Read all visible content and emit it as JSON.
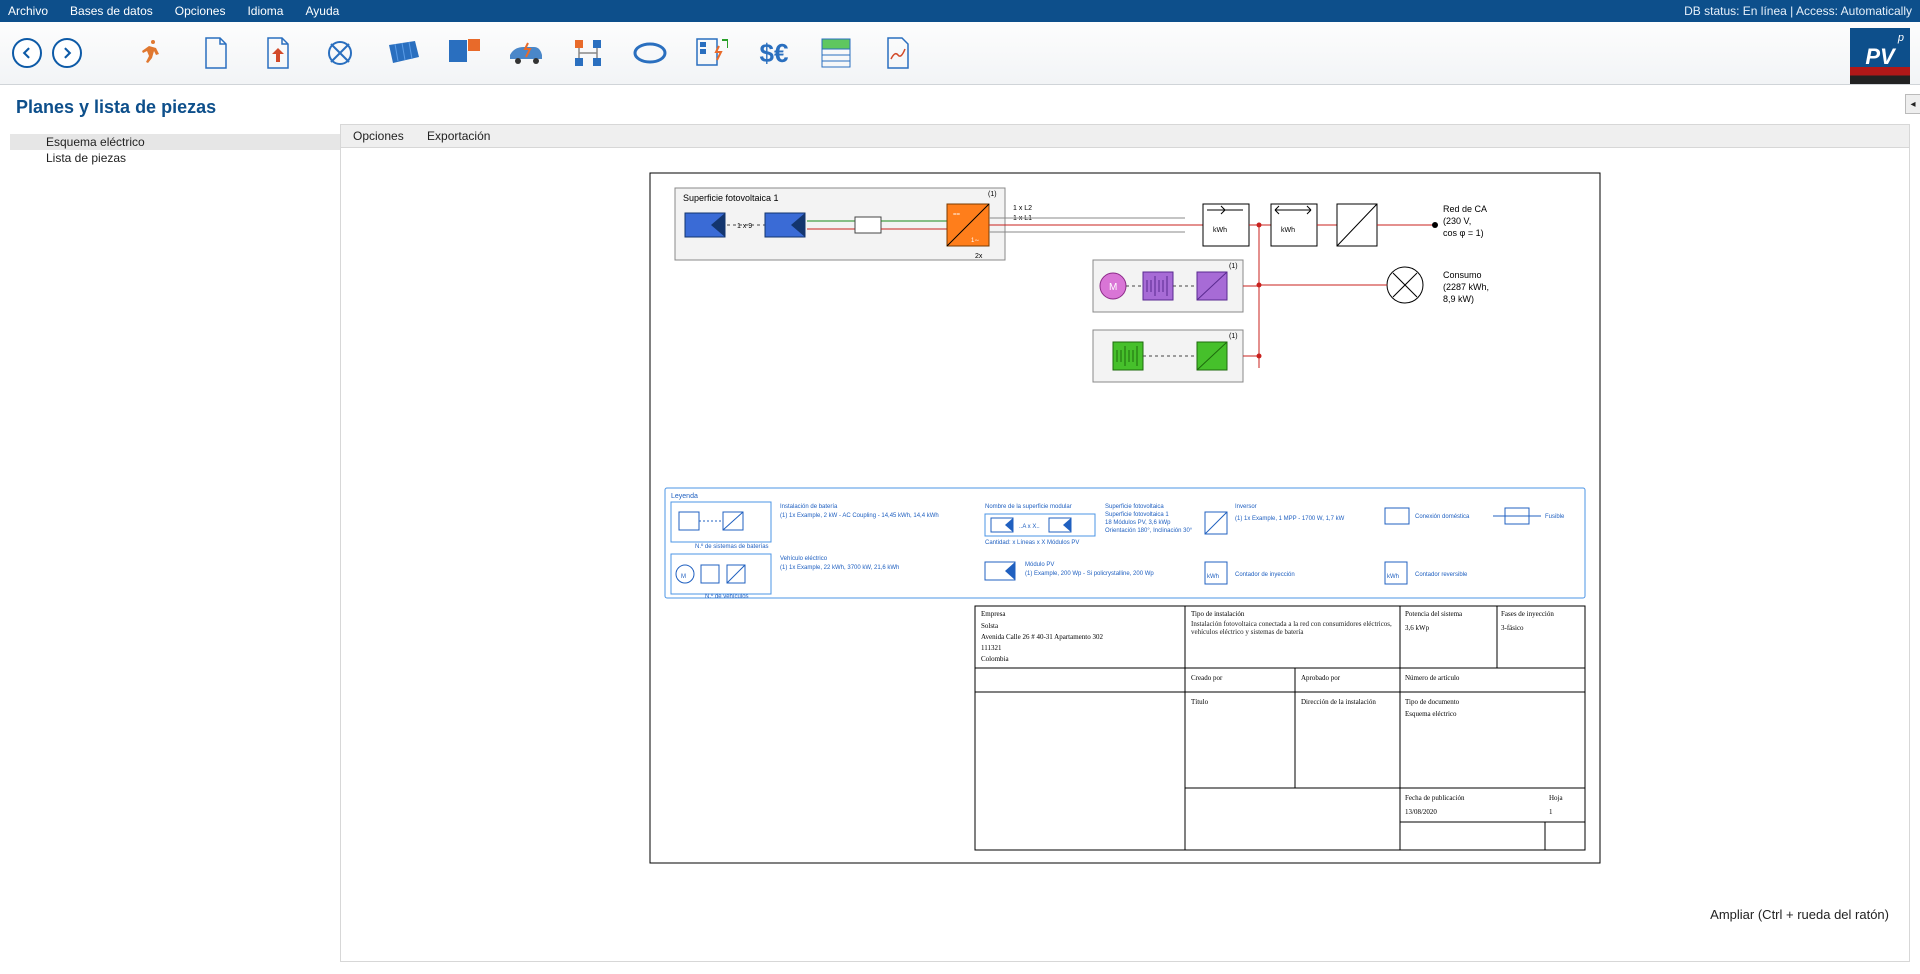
{
  "menu": {
    "items": [
      "Archivo",
      "Bases de datos",
      "Opciones",
      "Idioma",
      "Ayuda"
    ],
    "status": "DB status: En línea | Access: Automatically"
  },
  "page": {
    "title": "Planes y lista de piezas"
  },
  "tree": {
    "items": [
      "Esquema eléctrico",
      "Lista de piezas"
    ],
    "selected": 0
  },
  "subtoolbar": {
    "items": [
      "Opciones",
      "Exportación"
    ]
  },
  "zoom_hint": "Ampliar  (Ctrl + rueda del ratón)",
  "diagram": {
    "surface_title": "Superficie fotovoltaica 1",
    "string_label": "1 x 9",
    "block_index": "(1)",
    "inv_lines": [
      "1 x L2",
      "1 x L1"
    ],
    "inv_count": "2x",
    "meter": "kWh",
    "grid": {
      "title": "Red de CA",
      "l1": "(230 V,",
      "l2": "cos φ = 1)"
    },
    "load": {
      "title": "Consumo",
      "l1": "(2287 kWh,",
      "l2": "8,9 kW)"
    },
    "ev_M": "M"
  },
  "legend": {
    "title": "Leyenda",
    "bat": {
      "h": "Instalación de batería",
      "d": "(1) 1x Example, 2 kW - AC Coupling - 14,45 kWh, 14,4 kWh",
      "f": "N.º de sistemas de baterías"
    },
    "ev": {
      "h": "Vehículo eléctrico",
      "d": "(1) 1x Example, 22 kWh, 3700 kW, 21,6 kWh",
      "f": "N.º de vehículos"
    },
    "surf": {
      "h": "Nombre de la superficie modular",
      "s1": "Superficie fotovoltaica",
      "s2": "Superficie fotovoltaica 1",
      "s3": "18 Módulos PV,  3,6 kWp",
      "s4": "Orientación 180°, Inclinación 30°",
      "s5": "Cantidad:  x Líneas x X Módulos PV",
      "s6": "Módulo PV",
      "s7": "(1) Example, 200 Wp - Si policrystalline, 200 Wp",
      "strg": "..A x X.."
    },
    "inv": {
      "h": "Inversor",
      "d": "(1) 1x Example, 1 MPP - 1700 W, 1,7 kW"
    },
    "dom": "Conexión doméstica",
    "fuse": "Fusible",
    "cin": "Contador de inyección",
    "crev": "Contador reversible"
  },
  "titleblock": {
    "company_h": "Empresa",
    "company": "Solsta",
    "addr1": "Avenida Calle 26 # 40-31 Apartamento 302",
    "addr2": "111321",
    "addr3": "Colombia",
    "type_h": "Tipo de instalación",
    "type": "Instalación fotovoltaica conectada a la red con consumidores eléctricos, vehículos eléctrico y sistemas de batería",
    "power_h": "Potencia del sistema",
    "phase_h": "Fases de inyección",
    "power": "3,6 kWp",
    "phase": "3-fásico",
    "created_h": "Creado por",
    "approved_h": "Aprobado por",
    "num_h": "Número de artículo",
    "title_h": "Título",
    "dir_h": "Dirección de la instalación",
    "doc_h": "Tipo de documento",
    "doc": "Esquema eléctrico",
    "date_h": "Fecha de publicación",
    "date": "13/08/2020",
    "sheet_h": "Hoja",
    "sheet": "1"
  }
}
